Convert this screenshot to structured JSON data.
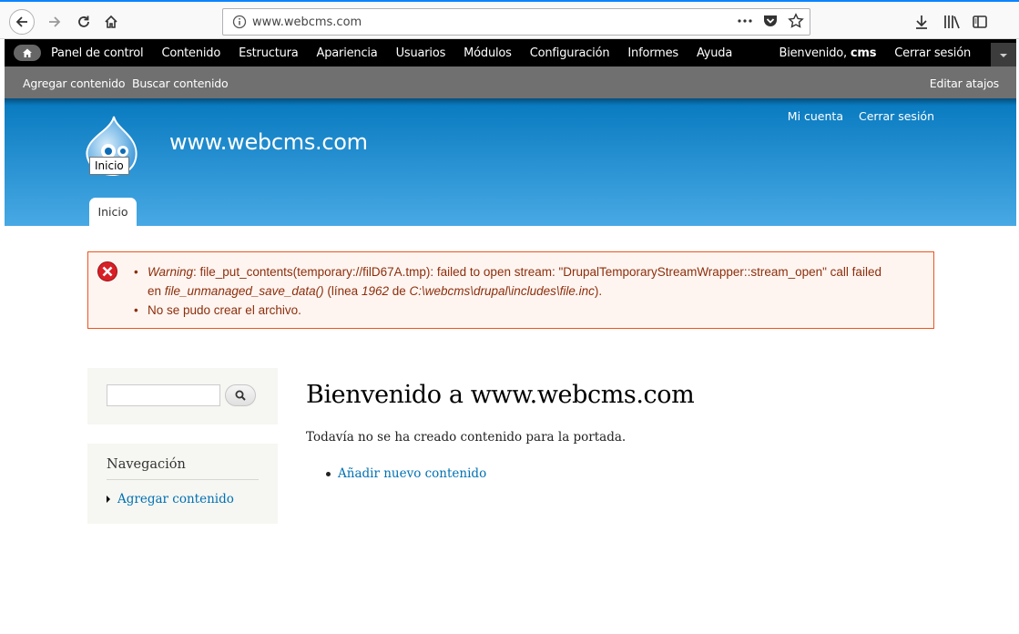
{
  "browser": {
    "url": "www.webcms.com"
  },
  "toolbar": {
    "menu": [
      "Panel de control",
      "Contenido",
      "Estructura",
      "Apariencia",
      "Usuarios",
      "Módulos",
      "Configuración",
      "Informes",
      "Ayuda"
    ],
    "welcome_prefix": "Bienvenido, ",
    "username": "cms",
    "logout": "Cerrar sesión"
  },
  "shortcuts": {
    "items": [
      "Agregar contenido",
      "Buscar contenido"
    ],
    "edit": "Editar atajos"
  },
  "header": {
    "site_name": "www.webcms.com",
    "logo_tooltip": "Inicio",
    "secondary_menu": [
      "Mi cuenta",
      "Cerrar sesión"
    ],
    "main_tab": "Inicio"
  },
  "messages": {
    "line1_label": "Warning",
    "line1_text": ": file_put_contents(temporary://filD67A.tmp): failed to open stream: \"DrupalTemporaryStreamWrapper::stream_open\" call failed",
    "line2_prefix": "en ",
    "line2_func": "file_unmanaged_save_data()",
    "line2_mid": " (línea ",
    "line2_line": "1962",
    "line2_de": " de ",
    "line2_path": "C:\\webcms\\drupal\\includes\\file.inc",
    "line2_end": ").",
    "line3": "No se pudo crear el archivo."
  },
  "sidebar": {
    "nav_title": "Navegación",
    "nav_link": "Agregar contenido"
  },
  "main": {
    "title": "Bienvenido a www.webcms.com",
    "text": "Todavía no se ha creado contenido para la portada.",
    "link": "Añadir nuevo contenido"
  },
  "colors": {
    "header_top": "#0779bf",
    "header_bottom": "#48a9e4",
    "error_border": "#ed541d",
    "error_bg": "#fef5f1",
    "link": "#0071b3"
  },
  "icons": [
    "back-arrow-icon",
    "forward-arrow-icon",
    "reload-icon",
    "home-icon",
    "info-icon",
    "more-icon",
    "pocket-icon",
    "star-icon",
    "download-icon",
    "library-icon",
    "sidebar-icon",
    "error-icon",
    "search-icon",
    "drupal-logo"
  ]
}
